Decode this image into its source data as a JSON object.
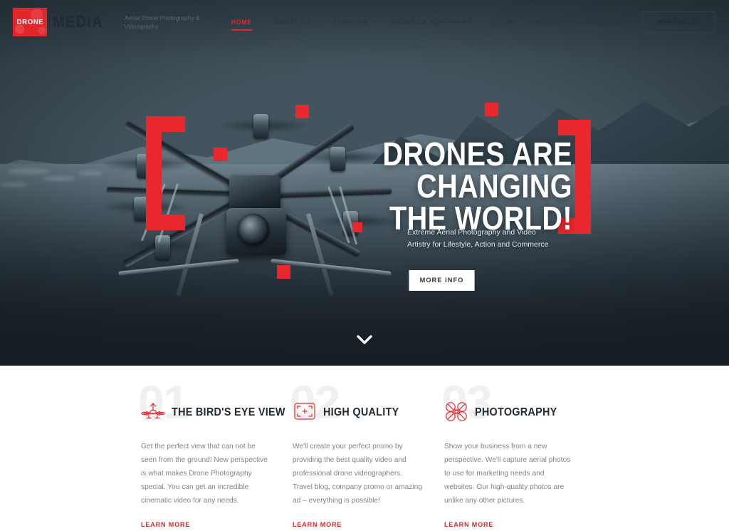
{
  "header": {
    "logo": {
      "badge_text": "DRONE",
      "word_text": "MEDIA"
    },
    "tagline": "Aerial Drone Photography & Videography",
    "nav": [
      {
        "label": "HOME",
        "active": true
      },
      {
        "label": "ABOUT US",
        "active": false
      },
      {
        "label": "SERVICES",
        "active": false
      },
      {
        "label": "DRONES & EQUIPMENT",
        "active": false
      },
      {
        "label": "SHOP",
        "active": false
      },
      {
        "label": "MEDIA",
        "active": false
      },
      {
        "label": "CONTACTS",
        "active": false
      }
    ],
    "portfolio_button": "PORTFOLIO"
  },
  "hero": {
    "title_line1": "DRONES ARE CHANGING",
    "title_line2": "THE WORLD!",
    "subtitle": "Extreme Aerial Photography and Video Artistry for Lifestyle, Action and Commerce",
    "cta_label": "MORE INFO",
    "scroll_icon": "chevron-down-icon"
  },
  "features": [
    {
      "number": "01",
      "icon": "drone-top-view-icon",
      "title": "THE BIRD'S EYE VIEW",
      "body": "Get the perfect view that can not be seen from the ground! New perspective is what makes Drone Photography special. You can get an incredible cinematic video for any needs.",
      "link_label": "LEARN MORE"
    },
    {
      "number": "02",
      "icon": "viewfinder-frame-icon",
      "title": "HIGH QUALITY",
      "body": "We'll create your perfect promo by providing the best quality video and professional drone videographers. Travel blog, company promo or amazing ad – everything is possible!",
      "link_label": "LEARN MORE"
    },
    {
      "number": "03",
      "icon": "quadcopter-icon",
      "title": "PHOTOGRAPHY",
      "body": "Show your business from a new perspective. We'll capture aerial photos to use for marketing needs and websites. Our high-quality photos are unlike any other pictures.",
      "link_label": "LEARN MORE"
    }
  ],
  "colors": {
    "accent_red": "#e2262c",
    "dark_text": "#1f2a32",
    "body_text": "#7d858b",
    "ghost_number": "#f0f0f0",
    "hero_dark": "#222c34"
  }
}
